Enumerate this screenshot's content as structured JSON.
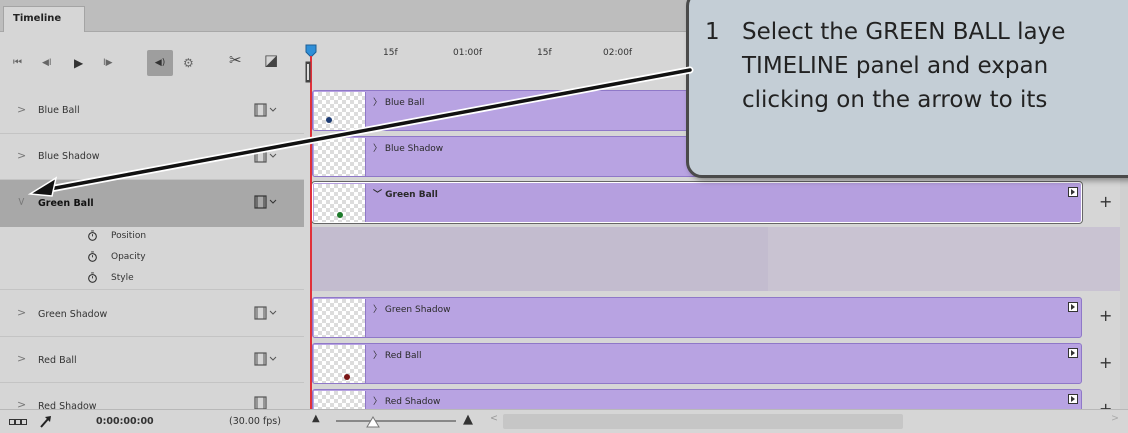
{
  "panel": {
    "tab_label": "Timeline"
  },
  "toolbar": {
    "first_frame_icon": "⏮",
    "prev_frame_icon": "◀I",
    "play_icon": "▶",
    "next_frame_icon": "I▶",
    "audio_icon": "◀)",
    "settings_icon": "⚙",
    "split_icon": "✂",
    "transition_icon": "◪"
  },
  "ruler": {
    "ticks": [
      "15f",
      "01:00f",
      "15f",
      "02:00f"
    ]
  },
  "layers": [
    {
      "name": "Blue Ball",
      "expanded": false,
      "selected": false
    },
    {
      "name": "Blue Shadow",
      "expanded": false,
      "selected": false
    },
    {
      "name": "Green Ball",
      "expanded": true,
      "selected": true
    },
    {
      "name": "Green Shadow",
      "expanded": false,
      "selected": false
    },
    {
      "name": "Red Ball",
      "expanded": false,
      "selected": false
    },
    {
      "name": "Red Shadow",
      "expanded": false,
      "selected": false
    }
  ],
  "properties": [
    {
      "name": "Position"
    },
    {
      "name": "Opacity"
    },
    {
      "name": "Style"
    }
  ],
  "tracks": [
    {
      "label": "Blue Ball",
      "ball_color": "#1d3c74"
    },
    {
      "label": "Blue Shadow",
      "ball_color": ""
    },
    {
      "label": "Green Ball",
      "ball_color": "#1d7a2a"
    },
    {
      "label": "Green Shadow",
      "ball_color": ""
    },
    {
      "label": "Red Ball",
      "ball_color": "#7a1515"
    },
    {
      "label": "Red Shadow",
      "ball_color": ""
    }
  ],
  "status": {
    "timecode": "0:00:00:00",
    "fps": "(30.00 fps)"
  },
  "callout": {
    "number": "1",
    "lines": [
      "Select the GREEN BALL laye",
      "TIMELINE panel and expan",
      "clicking on the arrow to its"
    ]
  },
  "colors": {
    "track": "#b8a3e2",
    "playhead": "#e0313a",
    "callout": "#c4ced6"
  }
}
